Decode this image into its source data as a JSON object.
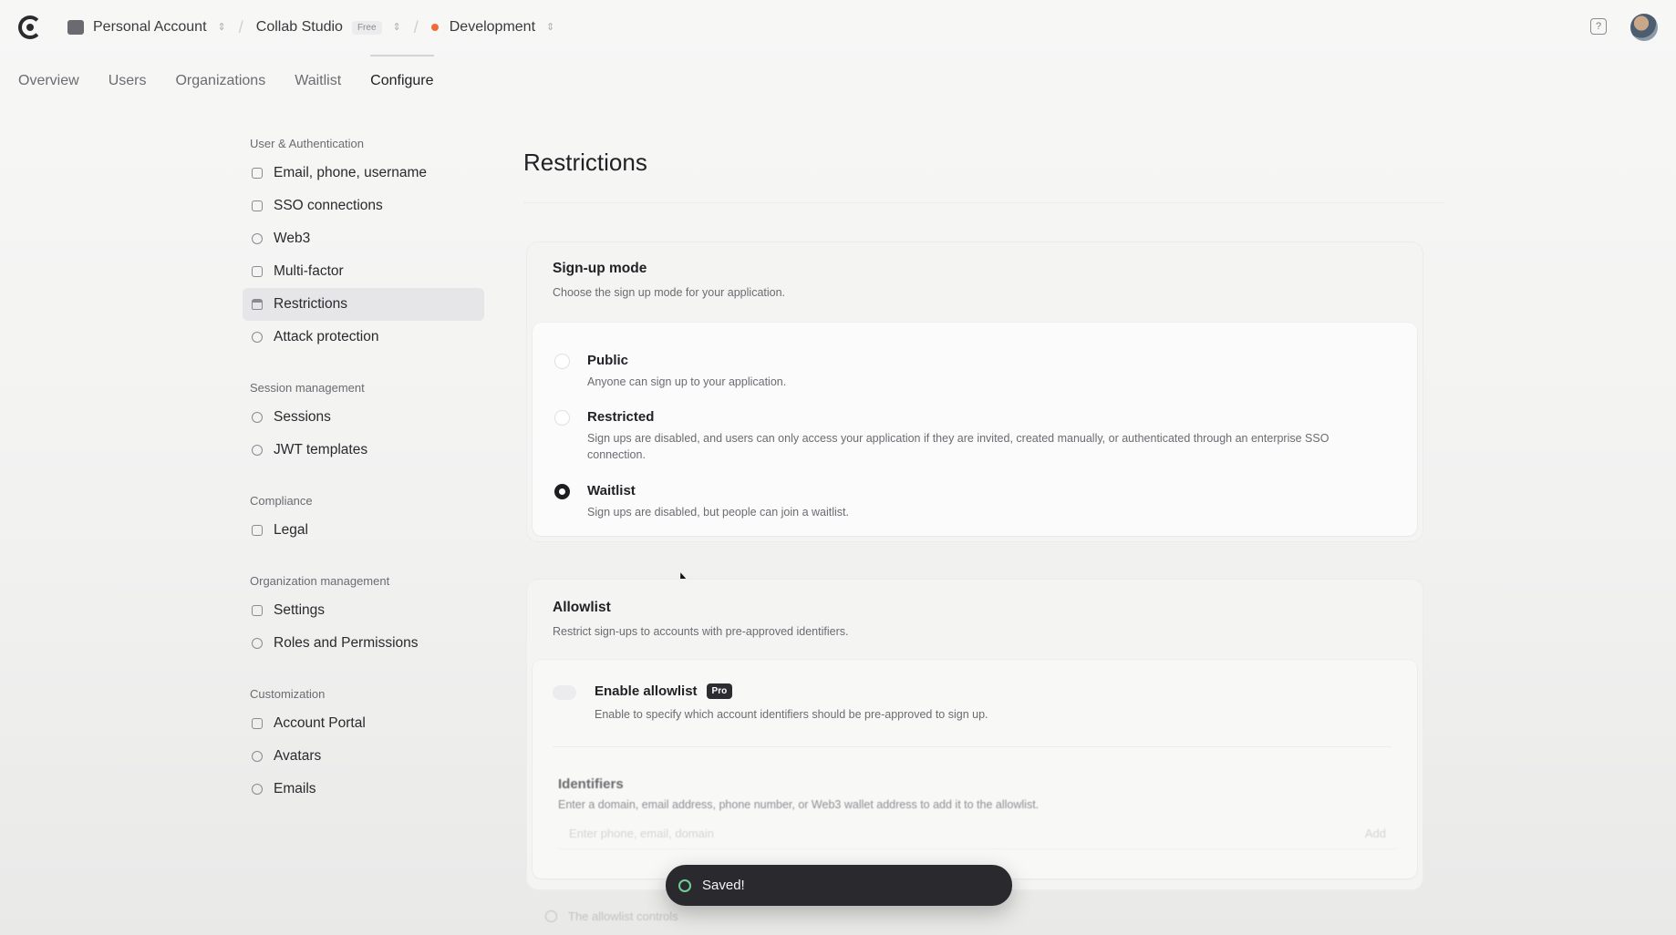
{
  "topbar": {
    "account": "Personal Account",
    "app": "Collab Studio",
    "app_badge": "Free",
    "environment": "Development"
  },
  "tabs": [
    {
      "label": "Overview"
    },
    {
      "label": "Users"
    },
    {
      "label": "Organizations"
    },
    {
      "label": "Waitlist"
    },
    {
      "label": "Configure"
    }
  ],
  "sidebar": {
    "sections": [
      {
        "title": "User & Authentication",
        "items": [
          "Email, phone, username",
          "SSO connections",
          "Web3",
          "Multi-factor",
          "Restrictions",
          "Attack protection"
        ]
      },
      {
        "title": "Session management",
        "items": [
          "Sessions",
          "JWT templates"
        ]
      },
      {
        "title": "Compliance",
        "items": [
          "Legal"
        ]
      },
      {
        "title": "Organization management",
        "items": [
          "Settings",
          "Roles and Permissions"
        ]
      },
      {
        "title": "Customization",
        "items": [
          "Account Portal",
          "Avatars",
          "Emails"
        ]
      }
    ],
    "active": "Restrictions"
  },
  "page": {
    "title": "Restrictions"
  },
  "signup": {
    "title": "Sign-up mode",
    "desc": "Choose the sign up mode for your application.",
    "options": [
      {
        "label": "Public",
        "desc": "Anyone can sign up to your application.",
        "selected": false
      },
      {
        "label": "Restricted",
        "desc": "Sign ups are disabled, and users can only access your application if they are invited, created manually, or authenticated through an enterprise SSO connection.",
        "selected": false
      },
      {
        "label": "Waitlist",
        "desc": "Sign ups are disabled, but people can join a waitlist.",
        "selected": true
      }
    ]
  },
  "allowlist": {
    "title": "Allowlist",
    "desc": "Restrict sign-ups to accounts with pre-approved identifiers.",
    "toggle_label": "Enable allowlist",
    "badge": "Pro",
    "toggle_desc": "Enable to specify which account identifiers should be pre-approved to sign up.",
    "identifiers_title": "Identifiers",
    "identifiers_desc": "Enter a domain, email address, phone number, or Web3 wallet address to add it to the allowlist.",
    "input_placeholder": "Enter phone, email, domain",
    "add_label": "Add",
    "footer_note": "The allowlist controls"
  },
  "toast": {
    "message": "Saved!"
  }
}
